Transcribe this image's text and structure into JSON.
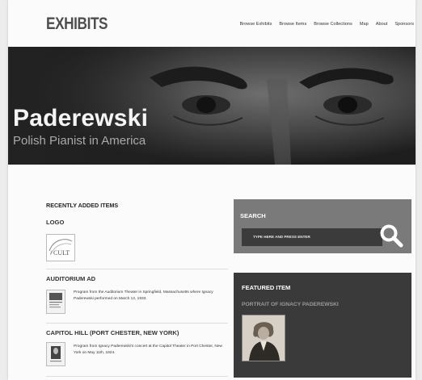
{
  "site": {
    "logo": "EXHIBITS"
  },
  "nav": [
    "Browse Exhibits",
    "Browse Items",
    "Browse Collections",
    "Map",
    "About",
    "Sponsors"
  ],
  "hero": {
    "title": "Paderewski",
    "subtitle": "Polish Pianist in America"
  },
  "recent": {
    "heading": "RECENTLY ADDED ITEMS",
    "items": [
      {
        "title": "LOGO",
        "thumb_text": "CULT",
        "description": ""
      },
      {
        "title": "AUDITORIUM AD",
        "description": "Program from the Auditorium Theater in Springfield, Massachusetts where Ignacy Paderewski performed on March 12, 1933."
      },
      {
        "title": "CAPITOL HILL (PORT CHESTER, NEW YORK)",
        "description": "Program from Ignacy Paderewski's concert at the Capitol Theater in Port Chester, New York on May 11th, 1924."
      }
    ]
  },
  "search": {
    "label": "SEARCH",
    "placeholder": "TYPE HERE AND PRESS ENTER"
  },
  "featured": {
    "label": "FEATURED ITEM",
    "title": "PORTRAIT OF IGNACY PADEREWSKI"
  },
  "colors": {
    "hero_bg": "#2c2c2c",
    "search_bg": "#7a7a7a",
    "featured_bg": "#3a3a3a"
  }
}
